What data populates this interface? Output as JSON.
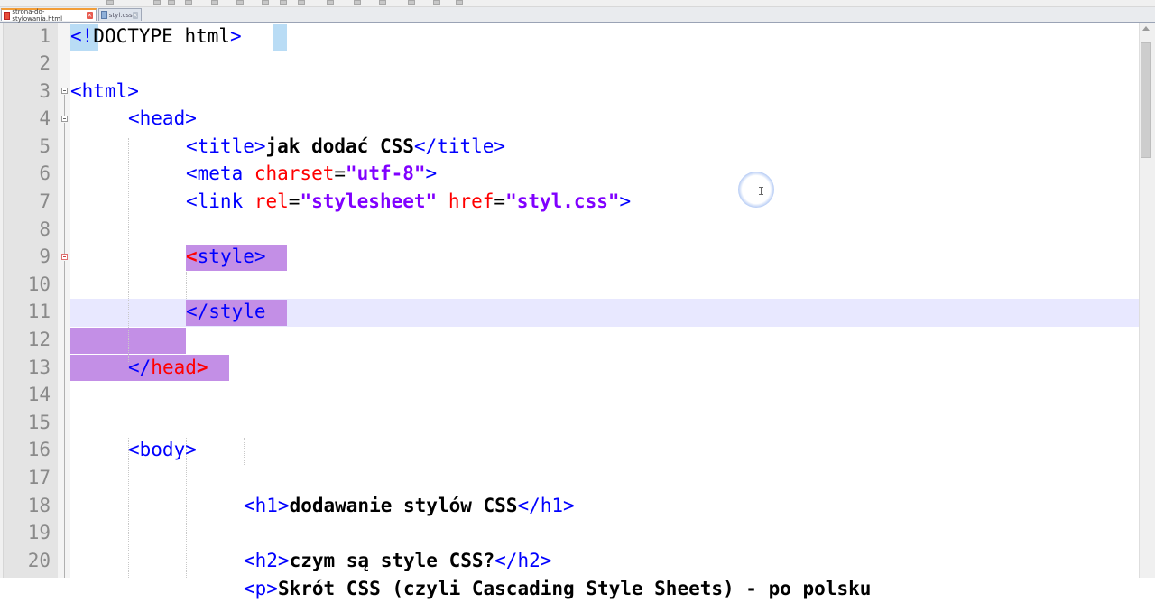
{
  "tabs": [
    {
      "label": "strona-do-stylowania.html",
      "active": true
    },
    {
      "label": "styl.css",
      "active": false
    }
  ],
  "editor": {
    "line_numbers": [
      "1",
      "2",
      "3",
      "4",
      "5",
      "6",
      "7",
      "8",
      "9",
      "10",
      "11",
      "12",
      "13",
      "14",
      "15",
      "16",
      "17",
      "18",
      "19",
      "20"
    ],
    "lines": {
      "l1": {
        "open": "<!",
        "kw": "DOCTYPE",
        "rest": " html",
        "close": ">"
      },
      "l3": {
        "tag": "<html>"
      },
      "l4": {
        "tag": "<head>"
      },
      "l5": {
        "open": "<title>",
        "text": "jak dodać CSS",
        "close": "</title>"
      },
      "l6": {
        "open": "<meta ",
        "attr": "charset",
        "eq": "=",
        "val": "\"utf-8\"",
        "close": ">"
      },
      "l7": {
        "open": "<link ",
        "attr1": "rel",
        "eq1": "=",
        "val1": "\"stylesheet\"",
        "sp": " ",
        "attr2": "href",
        "eq2": "=",
        "val2": "\"styl.css\"",
        "close": ">"
      },
      "l9": {
        "lt": "<",
        "rest": "style>"
      },
      "l11": {
        "tag": "</style"
      },
      "l13": {
        "open": "</",
        "name": "head",
        "close": ">"
      },
      "l15": {
        "tag": "<body>"
      },
      "l17": {
        "open": "<h1>",
        "text": "dodawanie stylów CSS",
        "close": "</h1>"
      },
      "l19": {
        "open": "<h2>",
        "text": "czym są style CSS?",
        "close": "</h2>"
      },
      "l20": {
        "open": "<p>",
        "text": "Skrót CSS (czyli Cascading Style Sheets) - po polsku"
      }
    }
  },
  "colors": {
    "tag": "#0000ff",
    "attribute": "#ff0000",
    "attr_value": "#8000ff",
    "match_highlight": "#c38fe6",
    "doctype_highlight": "#b9dcf5",
    "current_line": "#e8e8ff",
    "active_tab_accent": "#f29d38"
  },
  "icons": [
    "html-file-icon",
    "css-file-icon",
    "close-tab-icon",
    "fold-marker-icon",
    "text-cursor-icon"
  ]
}
